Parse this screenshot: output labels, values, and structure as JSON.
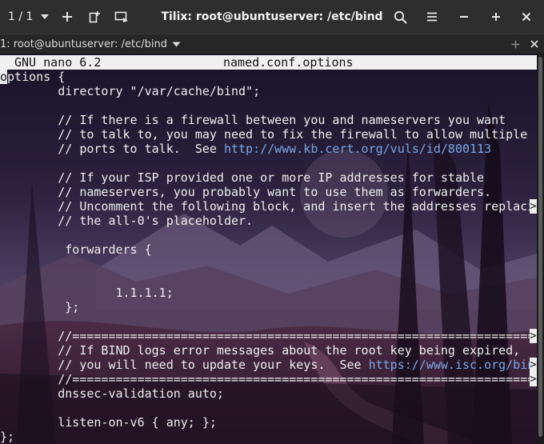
{
  "titlebar": {
    "session_count": "1 / 1",
    "window_title": "Tilix: root@ubuntuserver: /etc/bind",
    "icons": [
      "chevron-down-icon",
      "plus-icon",
      "add-session-icon",
      "sync-input-icon",
      "search-icon",
      "hamburger-menu-icon",
      "minimize-icon",
      "maximize-icon",
      "close-icon"
    ]
  },
  "tab": {
    "title": "1: root@ubuntuserver: /etc/bind",
    "icons": [
      "chevron-down-icon",
      "add-terminal-icon",
      "close-terminal-icon"
    ]
  },
  "nano": {
    "version": "GNU nano 6.2",
    "filename": "named.conf.options",
    "lines": [
      {
        "text": "options {",
        "cursor": true
      },
      {
        "text": "        directory \"/var/cache/bind\";"
      },
      {
        "text": ""
      },
      {
        "text": "        // If there is a firewall between you and nameservers you want"
      },
      {
        "text": "        // to talk to, you may need to fix the firewall to allow multiple"
      },
      {
        "text": "        // ports to talk.  See ",
        "url": "http://www.kb.cert.org/vuls/id/800113"
      },
      {
        "text": ""
      },
      {
        "text": "        // If your ISP provided one or more IP addresses for stable"
      },
      {
        "text": "        // nameservers, you probably want to use them as forwarders."
      },
      {
        "text": "        // Uncomment the following block, and insert the addresses replaci",
        "truncated": true
      },
      {
        "text": "        // the all-0's placeholder."
      },
      {
        "text": ""
      },
      {
        "text": "         forwarders {"
      },
      {
        "text": ""
      },
      {
        "text": ""
      },
      {
        "text": "                1.1.1.1;"
      },
      {
        "text": "         };"
      },
      {
        "text": ""
      },
      {
        "text": "        //=========================================================================",
        "truncated": true
      },
      {
        "text": "        // If BIND logs error messages about the root key being expired,"
      },
      {
        "text": "        // you will need to update your keys.  See ",
        "url": "https://www.isc.org/bin",
        "truncated": true
      },
      {
        "text": "        //=========================================================================",
        "truncated": true
      },
      {
        "text": "        dnssec-validation auto;"
      },
      {
        "text": ""
      },
      {
        "text": "        listen-on-v6 { any; };"
      },
      {
        "text": "};"
      }
    ],
    "truncation_marker": ">"
  },
  "colors": {
    "titlebar_bg": "#2e2e2e",
    "tabbar_bg": "#262626",
    "url": "#79a6e3",
    "text": "#eeeeee",
    "header_bg": "#f0f0f0"
  }
}
